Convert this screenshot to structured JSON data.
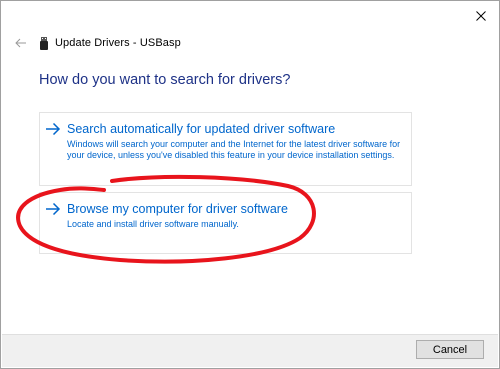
{
  "window": {
    "title": "Update Drivers - USBasp"
  },
  "heading": "How do you want to search for drivers?",
  "options": [
    {
      "title": "Search automatically for updated driver software",
      "description": "Windows will search your computer and the Internet for the latest driver software for your device, unless you've disabled this feature in your device installation settings."
    },
    {
      "title": "Browse my computer for driver software",
      "description": "Locate and install driver software manually."
    }
  ],
  "footer": {
    "cancel_label": "Cancel"
  },
  "icons": {
    "close": "close-icon",
    "back": "back-arrow-icon",
    "device": "usb-device-icon",
    "option_arrow": "arrow-right-icon"
  },
  "colors": {
    "heading": "#1e3287",
    "link": "#0066cc",
    "annotation": "#e8141c",
    "footer_bg": "#f0f0f0"
  }
}
